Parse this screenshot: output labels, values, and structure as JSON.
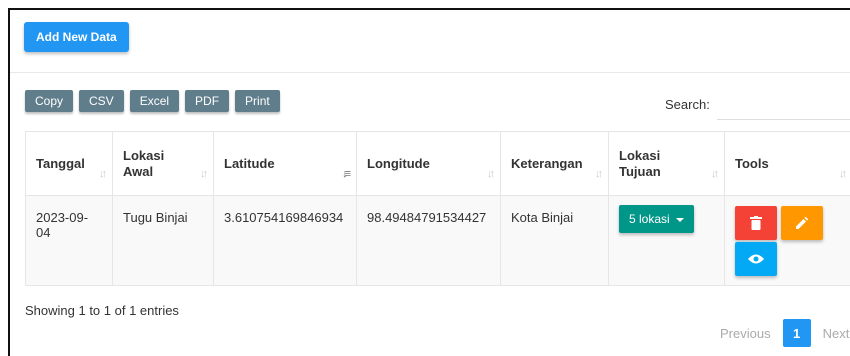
{
  "toolbar": {
    "add_label": "Add New Data"
  },
  "export_buttons": [
    "Copy",
    "CSV",
    "Excel",
    "PDF",
    "Print"
  ],
  "search": {
    "label": "Search:",
    "placeholder": "",
    "value": ""
  },
  "table": {
    "headers": [
      {
        "label": "Tanggal"
      },
      {
        "label": "Lokasi Awal"
      },
      {
        "label": "Latitude"
      },
      {
        "label": "Longitude"
      },
      {
        "label": "Keterangan"
      },
      {
        "label": "Lokasi Tujuan"
      },
      {
        "label": "Tools"
      }
    ],
    "rows": [
      {
        "tanggal": "2023-09-04",
        "lokasi_awal": "Tugu Binjai",
        "latitude": "3.610754169846934",
        "longitude": "98.49484791534427",
        "keterangan": "Kota Binjai",
        "lokasi_tujuan_button": "5 lokasi"
      }
    ],
    "tool_icons": [
      "trash-icon",
      "pencil-icon",
      "eye-icon"
    ]
  },
  "info_text": "Showing 1 to 1 of 1 entries",
  "pagination": {
    "previous": "Previous",
    "current_page": "1",
    "next": "Next"
  },
  "colors": {
    "primary": "#2196f3",
    "export": "#607d8b",
    "teal": "#009688",
    "delete": "#f44336",
    "edit": "#ff9800",
    "view": "#03a9f4"
  }
}
